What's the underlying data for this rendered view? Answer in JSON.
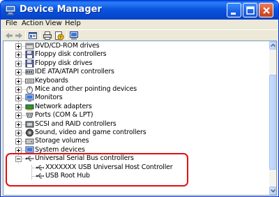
{
  "window": {
    "title": "Device Manager",
    "title_icon": "computer-icon",
    "controls": [
      "minimize-icon",
      "maximize-icon",
      "close-icon"
    ]
  },
  "menu": {
    "file": "File",
    "action": "Action",
    "view": "View",
    "help": "Help"
  },
  "toolbar": {
    "icons": [
      "back-arrow-icon",
      "forward-arrow-icon",
      "properties-icon",
      "print-icon",
      "help-icon",
      "scan-hardware-icon"
    ]
  },
  "tree": {
    "items": [
      {
        "label": "DVD/CD-ROM drives",
        "icon": "cdrom-icon",
        "expander": "plus"
      },
      {
        "label": "Floppy disk controllers",
        "icon": "floppy-controller-icon",
        "expander": "plus"
      },
      {
        "label": "Floppy disk drives",
        "icon": "floppy-drive-icon",
        "expander": "plus"
      },
      {
        "label": "IDE ATA/ATAPI controllers",
        "icon": "ide-controller-icon",
        "expander": "plus"
      },
      {
        "label": "Keyboards",
        "icon": "keyboard-icon",
        "expander": "plus"
      },
      {
        "label": "Mice and other pointing devices",
        "icon": "mouse-icon",
        "expander": "plus"
      },
      {
        "label": "Monitors",
        "icon": "monitor-icon",
        "expander": "plus"
      },
      {
        "label": "Network adapters",
        "icon": "network-adapter-icon",
        "expander": "plus"
      },
      {
        "label": "Ports (COM & LPT)",
        "icon": "port-icon",
        "expander": "plus"
      },
      {
        "label": "SCSI and RAID controllers",
        "icon": "scsi-icon",
        "expander": "plus"
      },
      {
        "label": "Sound, video and game controllers",
        "icon": "sound-icon",
        "expander": "plus"
      },
      {
        "label": "Storage volumes",
        "icon": "storage-icon",
        "expander": "plus"
      },
      {
        "label": "System devices",
        "icon": "system-device-icon",
        "expander": "plus"
      },
      {
        "label": "Universal Serial Bus controllers",
        "icon": "usb-icon",
        "expander": "minus"
      },
      {
        "label": "XXXXXXX USB Universal Host Controller",
        "icon": "usb-icon",
        "child": true
      },
      {
        "label": "USB Root Hub",
        "icon": "usb-icon",
        "child": true
      }
    ]
  },
  "colors": {
    "highlight": "#e01010",
    "titlebar": "#0a55e0"
  }
}
